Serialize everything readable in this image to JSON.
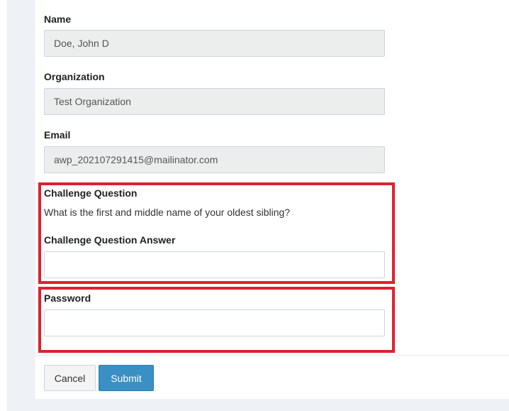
{
  "form": {
    "name_label": "Name",
    "name_value": "Doe, John D",
    "organization_label": "Organization",
    "organization_value": "Test Organization",
    "email_label": "Email",
    "email_value": "awp_202107291415@mailinator.com",
    "challenge_question_label": "Challenge Question",
    "challenge_question_text": "What is the first and middle name of your oldest sibling?",
    "challenge_answer_label": "Challenge Question Answer",
    "challenge_answer_value": "",
    "password_label": "Password",
    "password_value": ""
  },
  "actions": {
    "cancel_label": "Cancel",
    "submit_label": "Submit",
    "submit_color": "#3a8fc4"
  },
  "highlight_color": "#e0202f"
}
